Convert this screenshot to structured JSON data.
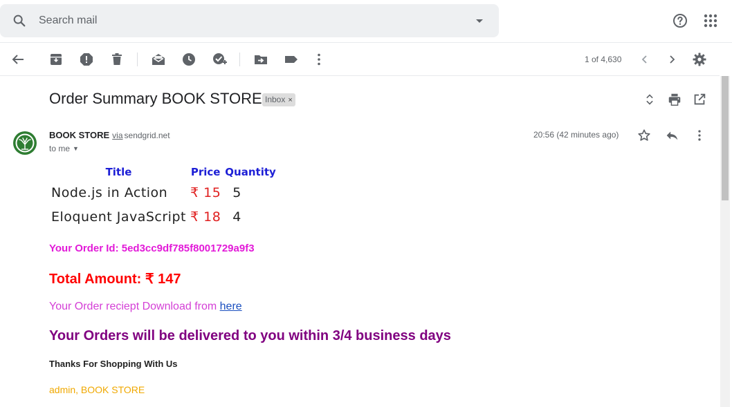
{
  "search": {
    "placeholder": "Search mail"
  },
  "toolbar": {
    "pager": "1 of 4,630"
  },
  "message": {
    "subject": "Order Summary BOOK STORE",
    "label": "Inbox",
    "label_close": "×",
    "sender_name": "BOOK STORE",
    "via": "via",
    "via_domain": "sendgrid.net",
    "to": "to me",
    "time": "20:56 (42 minutes ago)"
  },
  "orders": {
    "headers": [
      "Title",
      "Price",
      "Quantity"
    ],
    "rows": [
      {
        "title": "Node.js in Action",
        "price": "₹ 15",
        "qty": "5"
      },
      {
        "title": "Eloquent JavaScript",
        "price": "₹ 18",
        "qty": "4"
      }
    ]
  },
  "body": {
    "order_id": "Your Order Id: 5ed3cc9df785f8001729a9f3",
    "total": "Total Amount: ₹ 147",
    "receipt_text": "Your Order reciept Download from ",
    "receipt_link": "here",
    "delivery": "Your Orders will be delivered to you within 3/4 business days",
    "thanks": "Thanks For Shopping With Us",
    "signature": "admin, BOOK STORE"
  },
  "colors": {
    "header_blue": "#1d1fd6",
    "price_red": "#e02020",
    "order_id_magenta": "#e21ad8",
    "total_red": "#ff0000",
    "receipt_pink": "#d43fd6",
    "delivery_purple": "#800080",
    "signature_orange": "#f0a800"
  }
}
